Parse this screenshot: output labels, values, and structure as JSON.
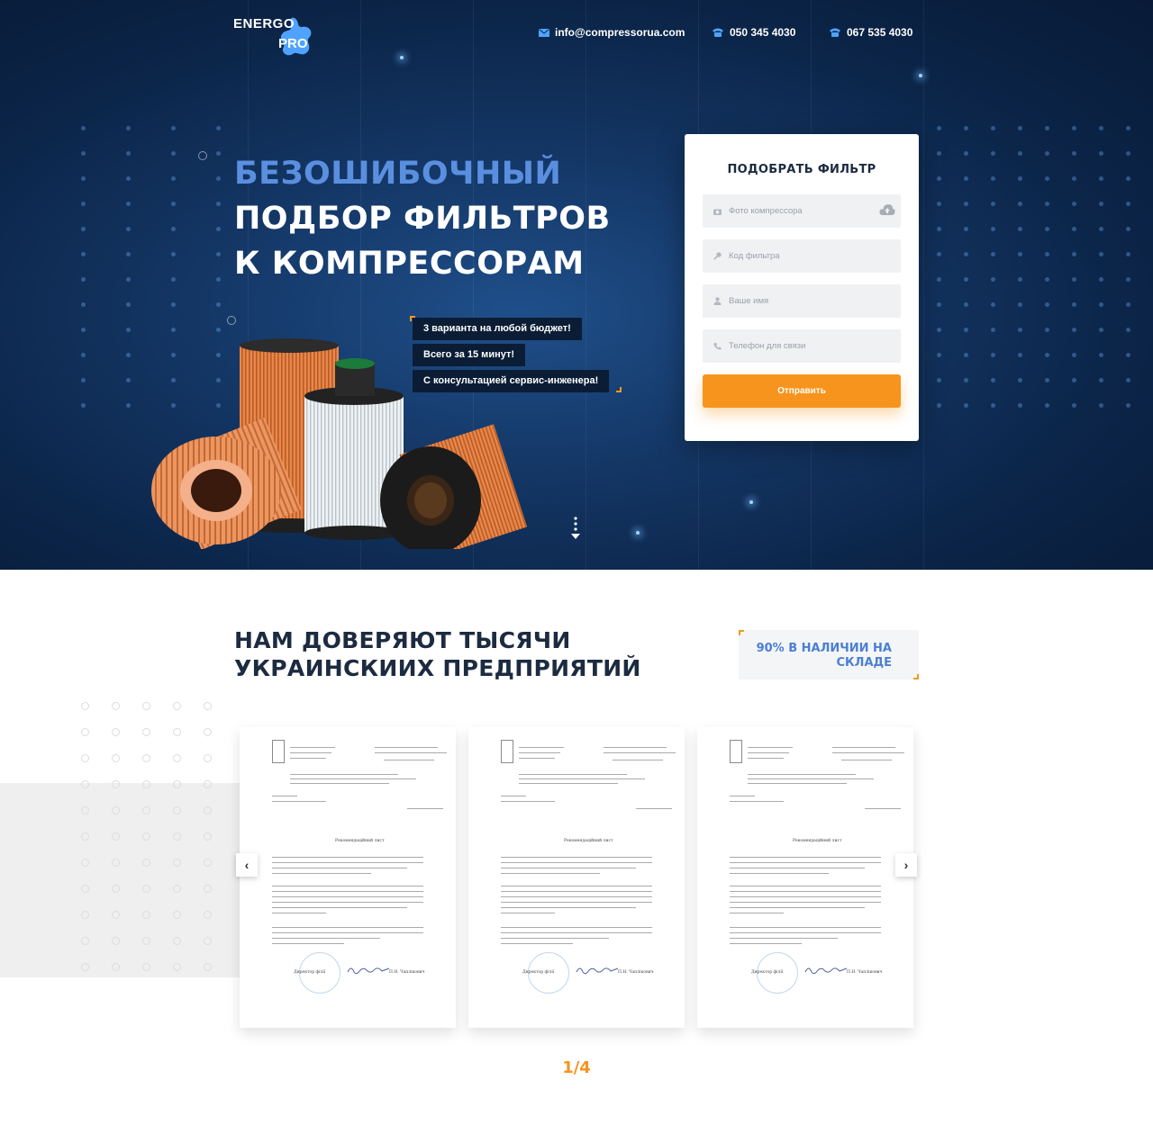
{
  "header": {
    "logo": {
      "line1": "ENERGO",
      "line2": "PRO"
    },
    "email": "info@compressorua.com",
    "phone1": "050 345 4030",
    "phone2": "067 535 4030"
  },
  "hero": {
    "headline": [
      "БЕЗОШИБОЧНЫЙ",
      "ПОДБОР ФИЛЬТРОВ",
      "К КОМПРЕССОРАМ"
    ],
    "badges": [
      "3 варианта на любой бюджет!",
      "Всего за 15 минут!",
      "С консультацией сервис-инженера!"
    ]
  },
  "form": {
    "title": "ПОДОБРАТЬ ФИЛЬТР",
    "fields": {
      "photo": "Фото компрессора",
      "code": "Код фильтра",
      "name": "Ваше имя",
      "phone": "Телефон для связи"
    },
    "submit": "Отправить"
  },
  "trust": {
    "title_line1": "НАМ ДОВЕРЯЮТ ТЫСЯЧИ",
    "title_line2": "УКРАИНСКИИХ ПРЕДПРИЯТИЙ",
    "stock_line1": "90% В НАЛИЧИИ НА",
    "stock_line2": "СКЛАДЕ",
    "letter_heading": "Рекомендаційний лист",
    "letter_sign": "Директор філії",
    "letter_name": "П.Н. Чаплікович",
    "pager": "1/4"
  },
  "colors": {
    "accent": "#f7941d",
    "brand_blue": "#5a8fe0",
    "dark_text": "#1c2b40"
  },
  "icons": [
    "mail-icon",
    "phone-icon",
    "camera-icon",
    "key-icon",
    "user-icon",
    "handset-icon",
    "cloud-upload-icon",
    "chevron-left-icon",
    "chevron-right-icon"
  ]
}
